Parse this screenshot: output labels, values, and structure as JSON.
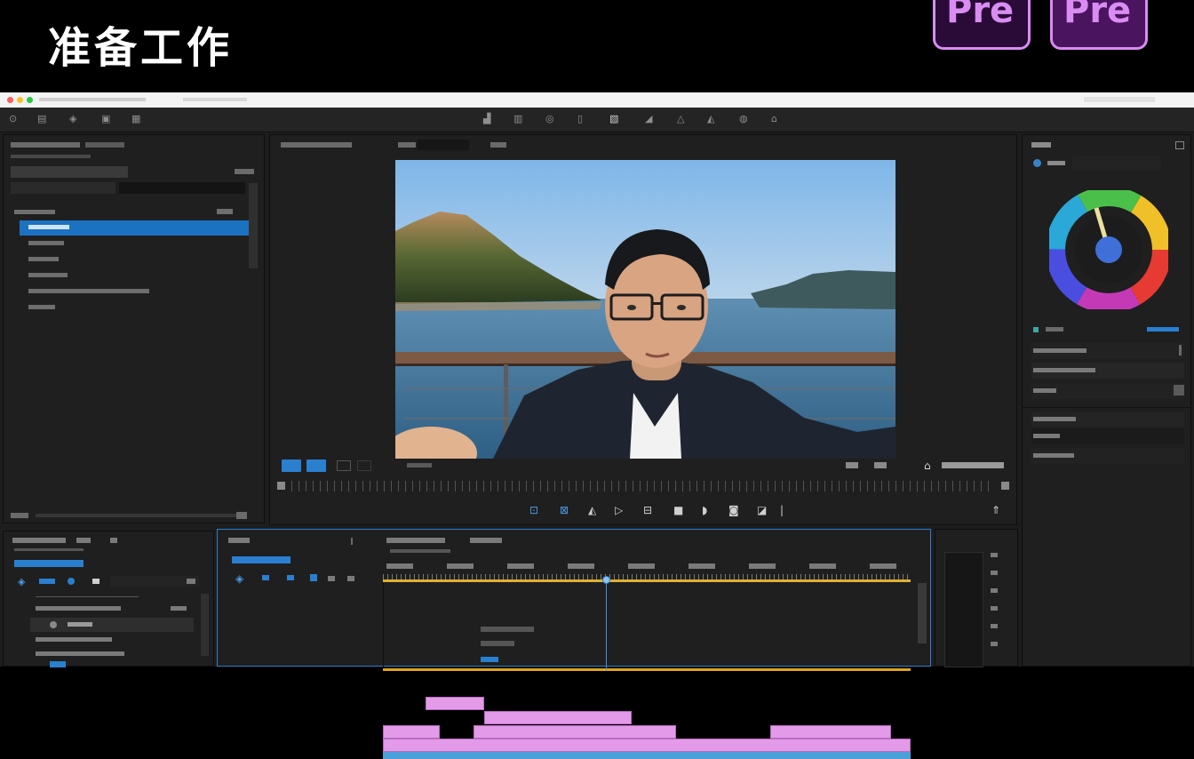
{
  "banner": {
    "title": "准备工作",
    "subtitle": "",
    "logos": [
      "Pre",
      "Pre"
    ]
  },
  "window": {
    "traffic_lights": [
      "#ff5f57",
      "#febc2e",
      "#28c840"
    ]
  },
  "toolbar": {
    "icons": [
      "home-icon",
      "import-icon",
      "export-icon",
      "edit-icon",
      "layers-icon",
      "color-icon",
      "effects-icon",
      "audio-icon",
      "graphics-icon",
      "library-icon",
      "transition-icon",
      "mask-icon",
      "share-icon"
    ]
  },
  "project_panel": {
    "selected_index": 1,
    "items_count": 6
  },
  "program_monitor": {
    "icons": [
      "play-icon",
      "step-icon",
      "loop-icon",
      "camera-icon",
      "settings-icon"
    ]
  },
  "lumetri": {
    "color_wheel": true
  },
  "timeline": {
    "playhead_percent": 43,
    "accent": "#2a7fcf",
    "clip_color": "#e39ae8",
    "audio_color": "#4aa0d8"
  },
  "colors": {
    "accent": "#1a72c0",
    "logo_accent": "#d98cf2"
  }
}
